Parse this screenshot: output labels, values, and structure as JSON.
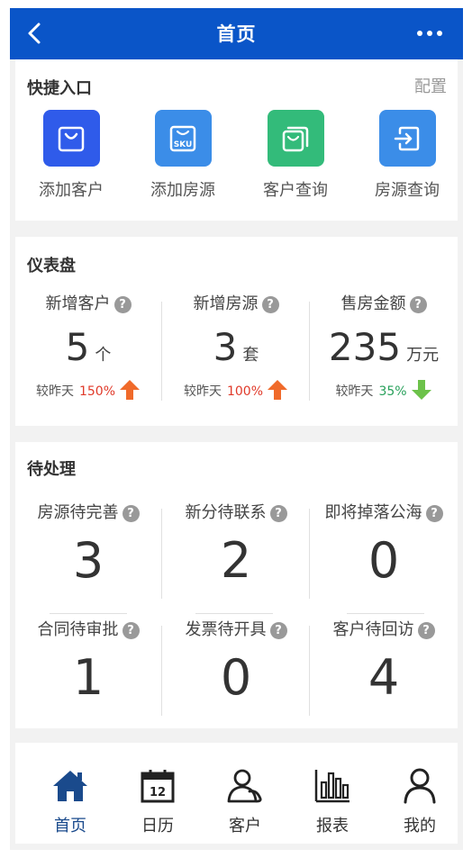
{
  "header": {
    "title": "首页",
    "back_icon": "back-chevron-icon",
    "more_icon": "more-dots-icon"
  },
  "quick_entry": {
    "title": "快捷入口",
    "config_label": "配置",
    "items": [
      {
        "label": "添加客户",
        "icon": "shopping-bag-icon",
        "color": "#2f5bea"
      },
      {
        "label": "添加房源",
        "icon": "sku-bag-icon",
        "color": "#3b8de8"
      },
      {
        "label": "客户查询",
        "icon": "copy-bag-icon",
        "color": "#33bb7a"
      },
      {
        "label": "房源查询",
        "icon": "exit-arrow-icon",
        "color": "#3b8de8"
      }
    ]
  },
  "dashboard": {
    "title": "仪表盘",
    "help_mark": "?",
    "metrics": [
      {
        "label": "新增客户",
        "value": "5",
        "unit": "个",
        "compare_label": "较昨天",
        "percent": "150%",
        "trend": "up",
        "color": "#e03a2a"
      },
      {
        "label": "新增房源",
        "value": "3",
        "unit": "套",
        "compare_label": "较昨天",
        "percent": "100%",
        "trend": "up",
        "color": "#e03a2a"
      },
      {
        "label": "售房金额",
        "value": "235",
        "unit": "万元",
        "compare_label": "较昨天",
        "percent": "35%",
        "trend": "down",
        "color": "#27a05a"
      }
    ]
  },
  "pending": {
    "title": "待处理",
    "help_mark": "?",
    "items": [
      {
        "label": "房源待完善",
        "value": "3"
      },
      {
        "label": "新分待联系",
        "value": "2"
      },
      {
        "label": "即将掉落公海",
        "value": "0"
      },
      {
        "label": "合同待审批",
        "value": "1"
      },
      {
        "label": "发票待开具",
        "value": "0"
      },
      {
        "label": "客户待回访",
        "value": "4"
      }
    ]
  },
  "nav": {
    "items": [
      {
        "label": "首页",
        "icon": "home-icon",
        "active": true
      },
      {
        "label": "日历",
        "icon": "calendar-icon",
        "day": "12"
      },
      {
        "label": "客户",
        "icon": "customers-icon"
      },
      {
        "label": "报表",
        "icon": "bar-chart-icon"
      },
      {
        "label": "我的",
        "icon": "person-icon"
      }
    ]
  },
  "colors": {
    "header_bg": "#0a55c8",
    "nav_active": "#1a4a8c",
    "page_bg": "#f2f2f2"
  }
}
